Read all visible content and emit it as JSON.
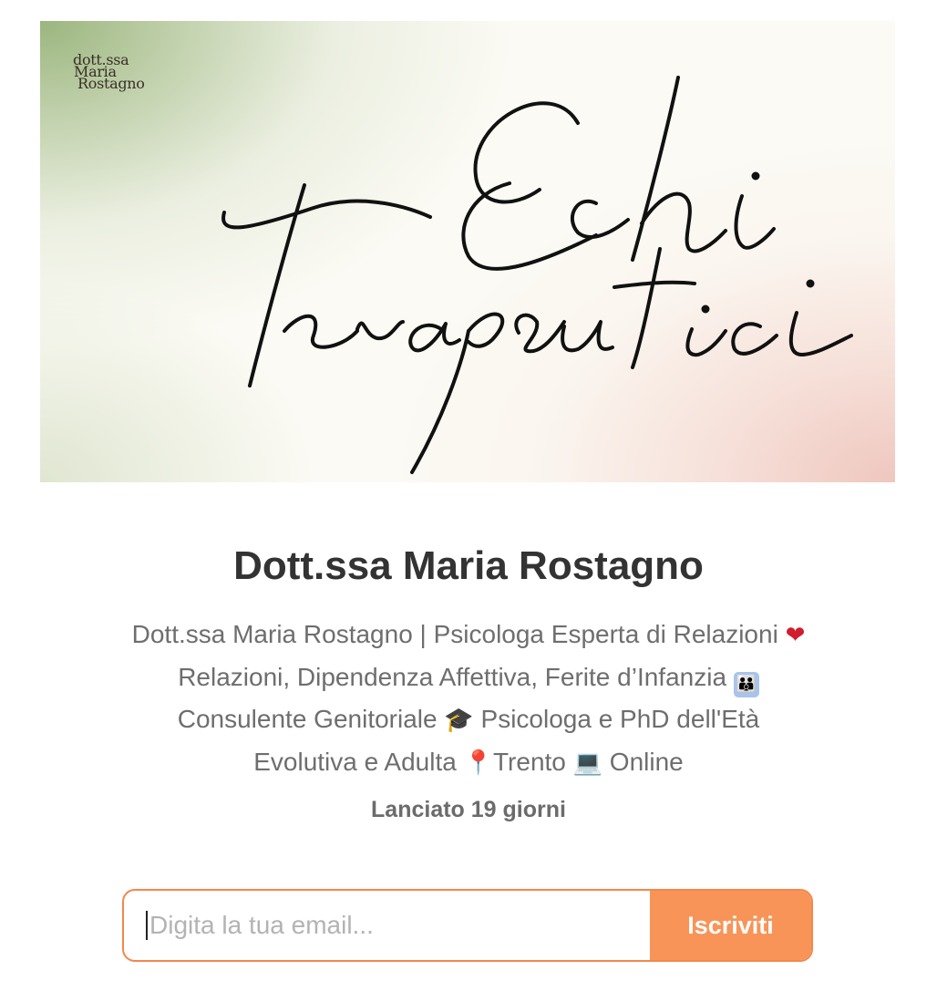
{
  "banner": {
    "logo_line1": "dott.ssa",
    "logo_line2": "Maria",
    "logo_line3": "Rostagno",
    "headline_line1": "Echi",
    "headline_line2": "Terapeutici"
  },
  "profile": {
    "title": "Dott.ssa Maria Rostagno",
    "bio_segments": {
      "s1": "Dott.ssa Maria Rostagno | Psicologa Esperta di Relazioni ",
      "heart_icon": "❤",
      "s2": " Relazioni, Dipendenza Affettiva, Ferite d’Infanzia ",
      "family_icon": "👪",
      "s3": " Consulente Genitoriale ",
      "graduation_icon": "🎓",
      "s4": " Psicologa e PhD dell'Età Evolutiva e Adulta ",
      "pin_icon": "📍",
      "s5": "Trento ",
      "laptop_icon": "💻",
      "s6": " Online"
    },
    "launched": "Lanciato 19 giorni"
  },
  "subscribe": {
    "email_placeholder": "Digita la tua email...",
    "button_label": "Iscriviti"
  },
  "colors": {
    "accent": "#f89457",
    "accent_border": "#f3874d",
    "title_text": "#333333",
    "body_text": "#6e6e6e"
  }
}
